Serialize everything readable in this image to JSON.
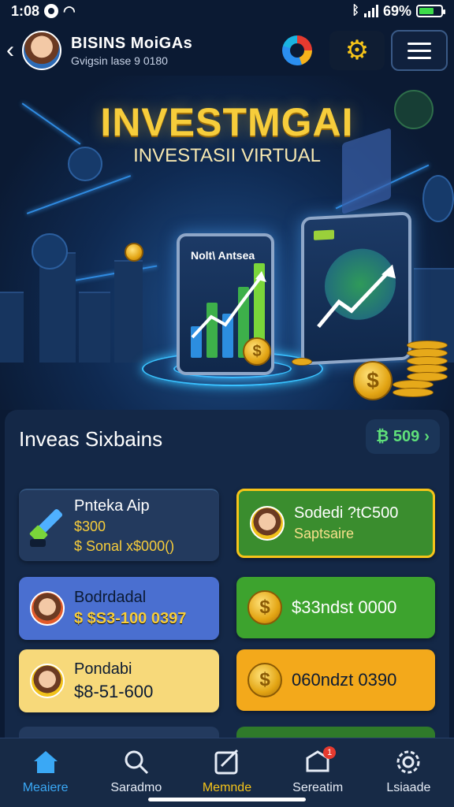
{
  "status_bar": {
    "time": "1:08",
    "battery_text": "69%",
    "battery_level": 0.69
  },
  "header": {
    "user_name": "BISINS MoiGAs",
    "user_sub": "Gvigsin lase 9 0180"
  },
  "hero": {
    "title": "INVESTMGAI",
    "subtitle": "INVESTASII VIRTUAL",
    "tablet_label": "Nolt\\ Antsea"
  },
  "section": {
    "title": "Inveas Sixbains",
    "balance": "₿ 509"
  },
  "cards": [
    {
      "title": "Pnteka Aip",
      "line1": "$300",
      "line2": "$ Sonal x$000()",
      "color": "#233a5e"
    },
    {
      "title": "Sodedi ?tC500",
      "line2": "Saptsaire",
      "color": "#3a8d2e"
    },
    {
      "title": "Bodrdadal",
      "line1": "$ $S3-100 0397",
      "color": "#4a6fd0"
    },
    {
      "title": "$33ndst 0000",
      "color": "#3da32e"
    },
    {
      "title": "Pondabi",
      "line1": "$8-51-600",
      "color": "#f7d97a"
    },
    {
      "title": "060ndzt 0390",
      "color": "#f3a91b"
    }
  ],
  "bottom_nav": [
    {
      "label": "Meaiere",
      "icon": "home-icon",
      "active": true
    },
    {
      "label": "Saradmo",
      "icon": "search-icon"
    },
    {
      "label": "Memnde",
      "icon": "edit-icon"
    },
    {
      "label": "Sereatim",
      "icon": "notification-icon",
      "badge": "1"
    },
    {
      "label": "Lsiaade",
      "icon": "settings-icon"
    }
  ],
  "colors": {
    "accent_gold": "#f7cd3b",
    "positive_green": "#5fe07a",
    "nav_active": "#3aa8f5",
    "nav_gold": "#f6c419"
  }
}
